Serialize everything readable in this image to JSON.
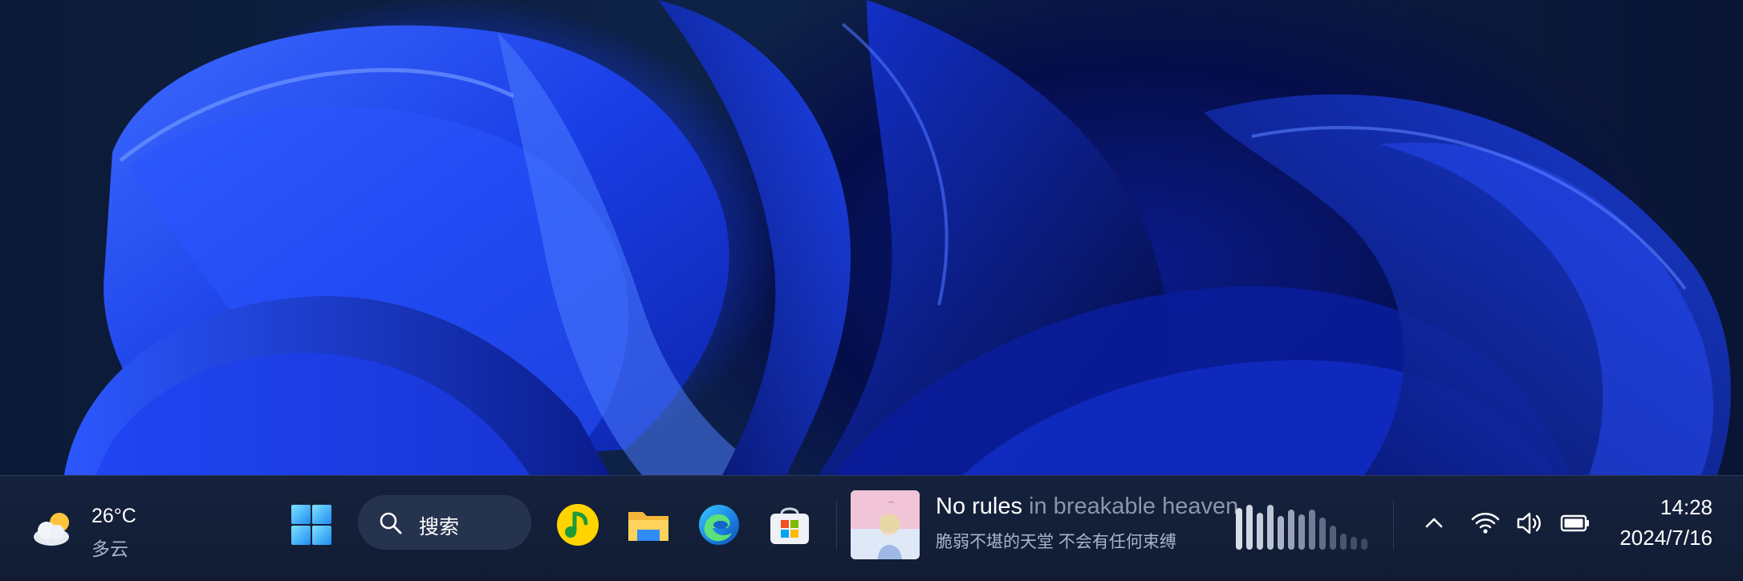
{
  "weather": {
    "temperature": "26°C",
    "condition": "多云",
    "icon": "partly-cloudy-icon"
  },
  "search": {
    "label": "搜索",
    "icon": "search-icon"
  },
  "apps": [
    {
      "name": "qq-music",
      "icon": "qq-music-icon"
    },
    {
      "name": "file-explorer",
      "icon": "folder-icon"
    },
    {
      "name": "edge",
      "icon": "edge-icon"
    },
    {
      "name": "microsoft-store",
      "icon": "store-icon"
    }
  ],
  "media": {
    "title_main": "No rules",
    "title_rest": " in breakable heaven",
    "lyric": "脆弱不堪的天堂 不会有任何束缚",
    "cover_icon": "album-cover"
  },
  "tray": {
    "overflow_icon": "chevron-up-icon",
    "wifi_icon": "wifi-icon",
    "volume_icon": "volume-icon",
    "battery_icon": "battery-icon"
  },
  "clock": {
    "time": "14:28",
    "date": "2024/7/16"
  },
  "colors": {
    "taskbar": "#131e38",
    "accent": "#1f3fff",
    "search_bg": "#26334f"
  }
}
